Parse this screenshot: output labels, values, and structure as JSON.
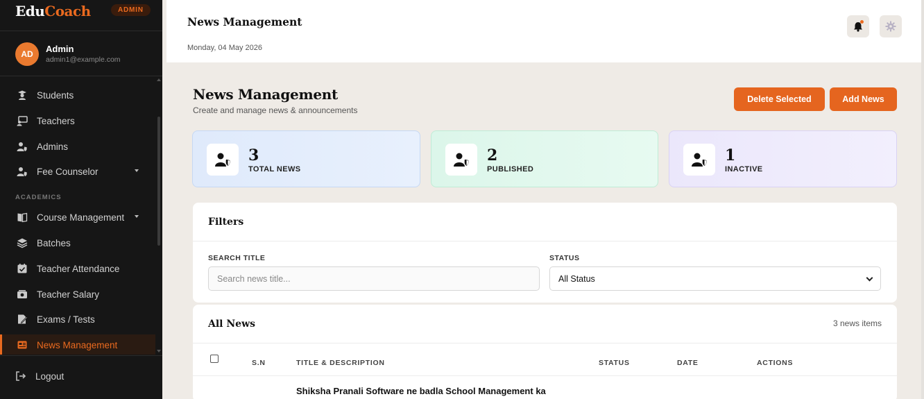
{
  "brand": {
    "part1": "Edu",
    "part2": "Coach",
    "badge": "ADMIN"
  },
  "user": {
    "initials": "AD",
    "name": "Admin",
    "email": "admin1@example.com"
  },
  "sidebar": {
    "sections": [
      "ACADEMICS"
    ],
    "items": [
      {
        "label": "Students",
        "icon": "student-icon"
      },
      {
        "label": "Teachers",
        "icon": "teacher-icon"
      },
      {
        "label": "Admins",
        "icon": "admin-user-icon"
      },
      {
        "label": "Fee Counselor",
        "icon": "counselor-icon"
      },
      {
        "label": "Course Management",
        "icon": "book-icon"
      },
      {
        "label": "Batches",
        "icon": "layers-icon"
      },
      {
        "label": "Teacher Attendance",
        "icon": "attendance-icon"
      },
      {
        "label": "Teacher Salary",
        "icon": "salary-icon"
      },
      {
        "label": "Exams / Tests",
        "icon": "exam-icon"
      },
      {
        "label": "News Management",
        "icon": "news-icon",
        "active": true
      }
    ],
    "logout": "Logout"
  },
  "topbar": {
    "title": "News Management",
    "date": "Monday, 04 May 2026"
  },
  "page": {
    "title": "News Management",
    "subtitle": "Create and manage news & announcements",
    "delete_label": "Delete Selected",
    "add_label": "Add News"
  },
  "stats": [
    {
      "value": "3",
      "label": "TOTAL NEWS"
    },
    {
      "value": "2",
      "label": "PUBLISHED"
    },
    {
      "value": "1",
      "label": "INACTIVE"
    }
  ],
  "filters": {
    "heading": "Filters",
    "search_label": "SEARCH TITLE",
    "search_placeholder": "Search news title...",
    "status_label": "STATUS",
    "status_value": "All Status"
  },
  "news": {
    "heading": "All News",
    "count": "3 news items",
    "columns": [
      "S.N",
      "TITLE & DESCRIPTION",
      "STATUS",
      "DATE",
      "ACTIONS"
    ],
    "rows": [
      {
        "title": "Shiksha Pranali Software ne badla School Management ka tareeka"
      }
    ]
  },
  "colors": {
    "accent": "#e5651f",
    "sidebar_bg": "#161616",
    "page_bg": "#efebe6"
  }
}
